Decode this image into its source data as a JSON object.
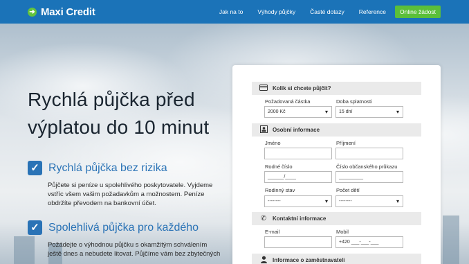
{
  "brand": {
    "name": "Maxi Credit",
    "icon": "arrow-circle-icon"
  },
  "nav": {
    "links": [
      "Jak na to",
      "Výhody půjčky",
      "Časté dotazy",
      "Reference"
    ],
    "cta": "Online žádost"
  },
  "hero": {
    "title": "Rychlá půjčka před výplatou do 10 minut",
    "features": [
      {
        "title": "Rychlá půjčka bez rizika",
        "text": "Půjčete si peníze u spolehlivého poskytovatele. Vyjdeme vstříc všem vašim požadavkům a možnostem. Peníze obdržíte převodem na bankovní účet."
      },
      {
        "title": "Spolehlivá půjčka pro každého",
        "text": "Požádejte o výhodnou půjčku s okamžitým schválením ještě dnes a nebudete litovat. Půjčíme vám bez zbytečných"
      }
    ]
  },
  "form": {
    "loan": {
      "heading": "Kolik si chcete půjčit?",
      "icon": "credit-card-icon",
      "amount_label": "Požadovaná částka",
      "amount_value": "2000 Kč",
      "term_label": "Doba splatnosti",
      "term_value": "15 dní"
    },
    "personal": {
      "heading": "Osobní informace",
      "icon": "id-card-icon",
      "first_name_label": "Jméno",
      "last_name_label": "Příjmení",
      "birth_number_label": "Rodné číslo",
      "birth_number_placeholder": "______/____",
      "id_card_label": "Číslo občanského průkazu",
      "id_card_placeholder": "_________",
      "marital_label": "Rodinný stav",
      "marital_value": "--------",
      "children_label": "Počet dětí",
      "children_value": "--------"
    },
    "contact": {
      "heading": "Kontaktní informace",
      "icon": "phone-icon",
      "email_label": "E-mail",
      "mobile_label": "Mobil",
      "mobile_placeholder": "+420 ___-___-___"
    },
    "employer": {
      "heading": "Informace o zaměstnavateli",
      "icon": "user-icon"
    }
  },
  "colors": {
    "header": "#1b73b8",
    "accent": "#2a73b6",
    "cta": "#5bbf3a"
  }
}
